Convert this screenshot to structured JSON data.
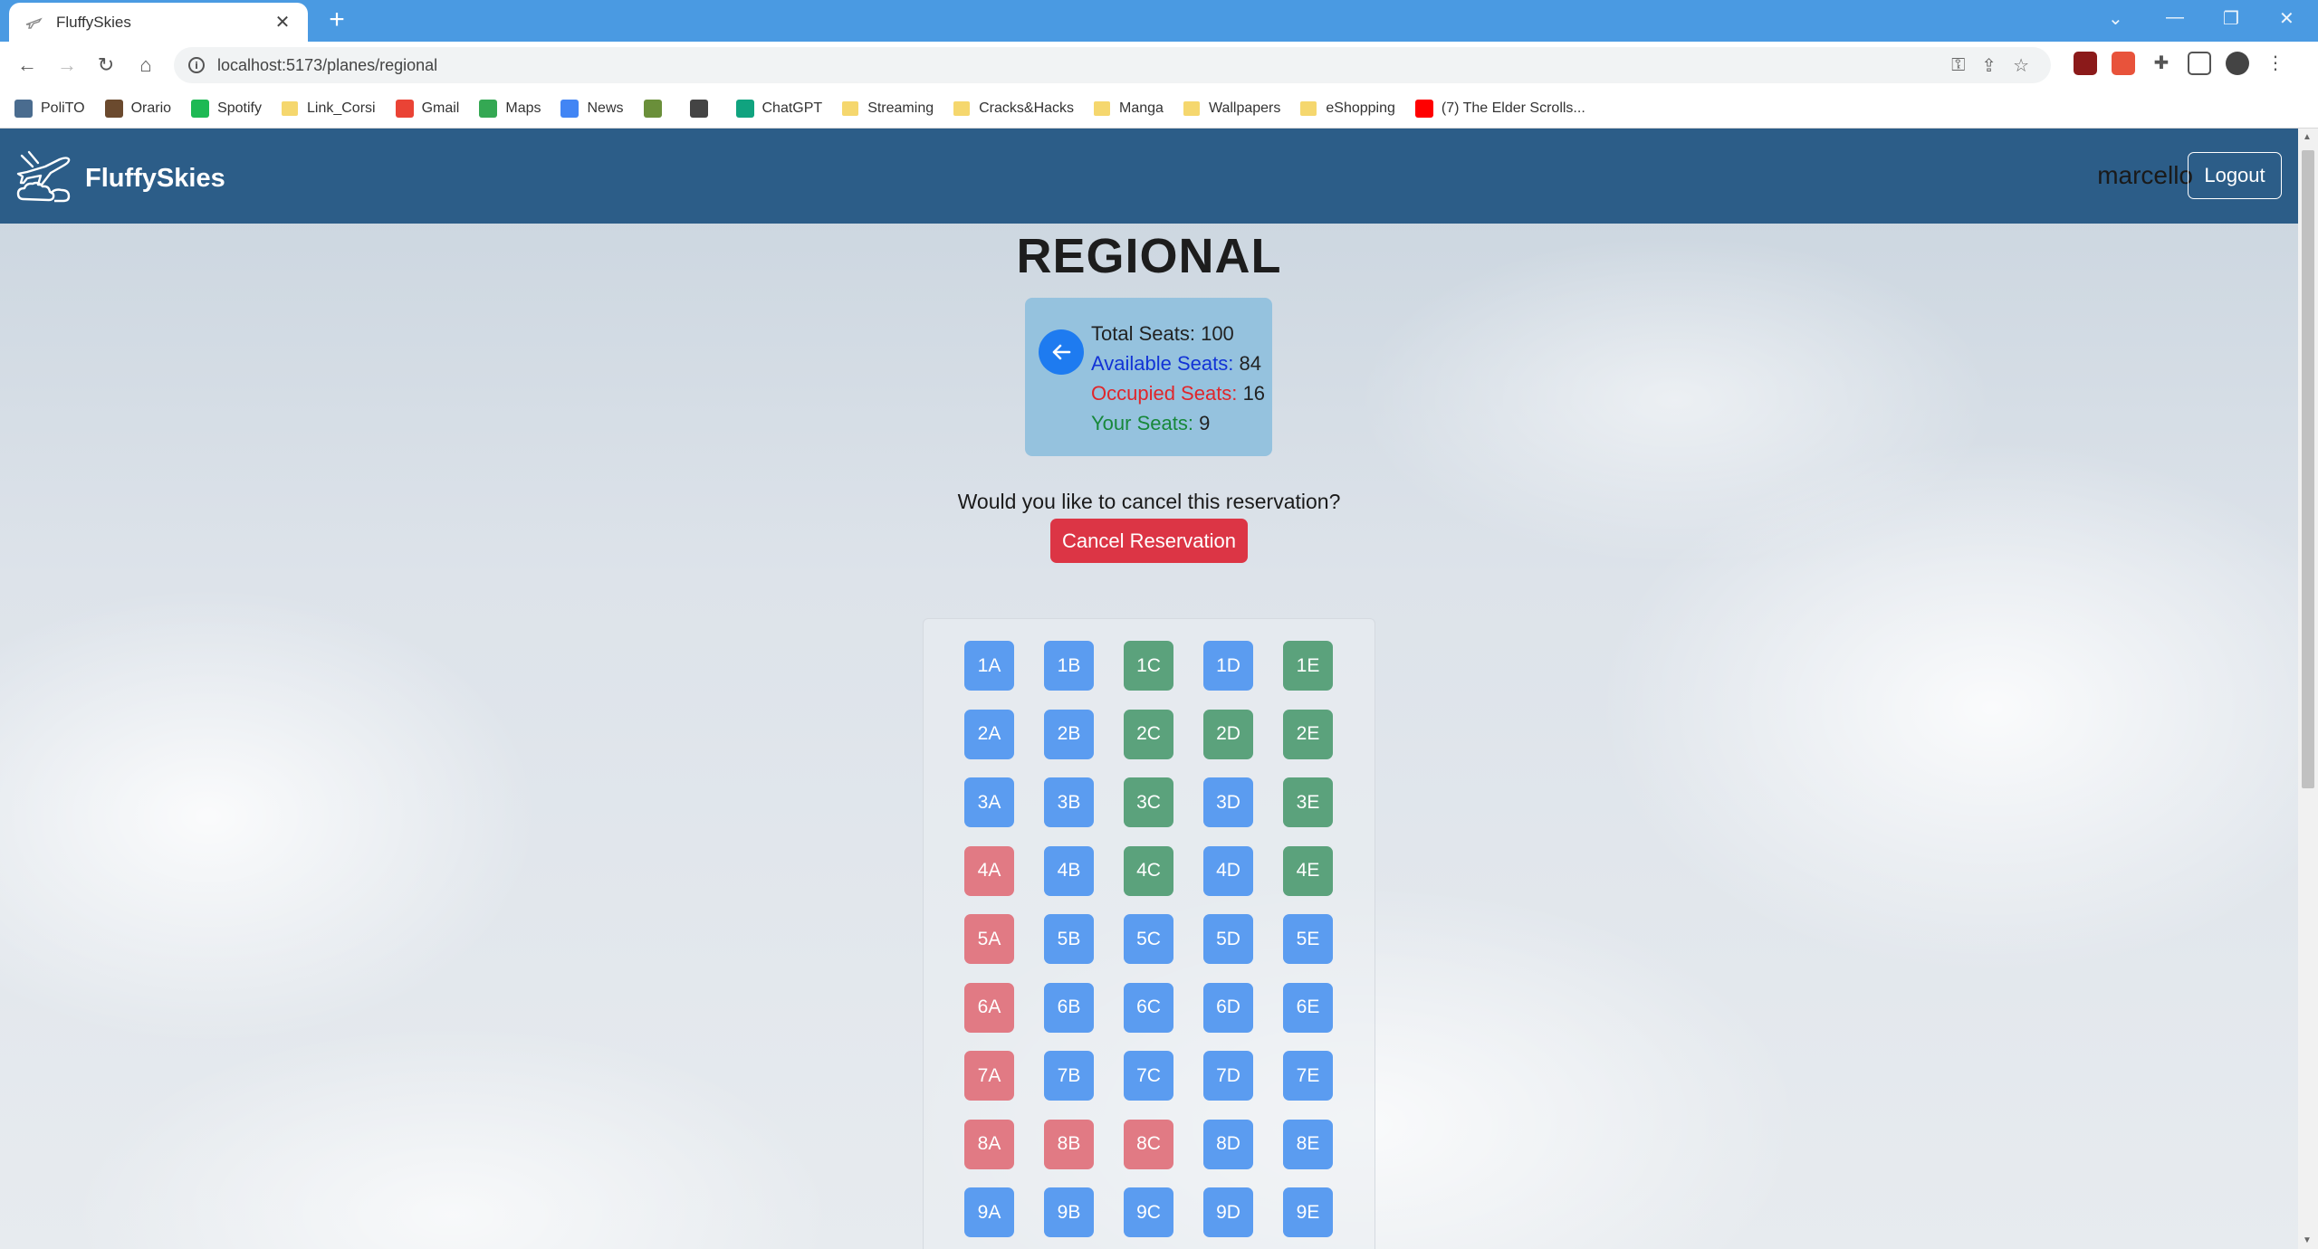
{
  "browser": {
    "tab_title": "FluffySkies",
    "url": "localhost:5173/planes/regional",
    "bookmarks": [
      {
        "label": "PoliTO",
        "color": "#4a6c8f"
      },
      {
        "label": "Orario",
        "color": "#6b4a2e"
      },
      {
        "label": "Spotify",
        "color": "#1db954"
      },
      {
        "label": "Link_Corsi",
        "color": "#f5d76e"
      },
      {
        "label": "Gmail",
        "color": "#ea4335"
      },
      {
        "label": "Maps",
        "color": "#34a853"
      },
      {
        "label": "News",
        "color": "#4285f4"
      },
      {
        "label": "",
        "color": "#6a8f3a"
      },
      {
        "label": "",
        "color": "#444444"
      },
      {
        "label": "ChatGPT",
        "color": "#10a37f"
      },
      {
        "label": "Streaming",
        "color": "#f5d76e"
      },
      {
        "label": "Cracks&Hacks",
        "color": "#f5d76e"
      },
      {
        "label": "Manga",
        "color": "#f5d76e"
      },
      {
        "label": "Wallpapers",
        "color": "#f5d76e"
      },
      {
        "label": "eShopping",
        "color": "#f5d76e"
      },
      {
        "label": "(7) The Elder Scrolls...",
        "color": "#ff0000"
      }
    ]
  },
  "navbar": {
    "brand": "FluffySkies",
    "username": "marcello",
    "logout_label": "Logout"
  },
  "plane": {
    "title": "REGIONAL",
    "total_label": "Total Seats:",
    "total_value": "100",
    "available_label": "Available Seats:",
    "available_value": "84",
    "occupied_label": "Occupied Seats:",
    "occupied_value": "16",
    "yours_label": "Your Seats:",
    "yours_value": "9"
  },
  "reservation": {
    "question": "Would you like to cancel this reservation?",
    "cancel_label": "Cancel Reservation"
  },
  "colors": {
    "available": "#5b9cf0",
    "yours": "#5ba27c",
    "occupied": "#e17a84",
    "navbar": "#2c5d88",
    "danger": "#dc3545"
  },
  "seats": [
    [
      {
        "id": "1A",
        "status": "available"
      },
      {
        "id": "1B",
        "status": "available"
      },
      {
        "id": "1C",
        "status": "yours"
      },
      {
        "id": "1D",
        "status": "available"
      },
      {
        "id": "1E",
        "status": "yours"
      }
    ],
    [
      {
        "id": "2A",
        "status": "available"
      },
      {
        "id": "2B",
        "status": "available"
      },
      {
        "id": "2C",
        "status": "yours"
      },
      {
        "id": "2D",
        "status": "yours"
      },
      {
        "id": "2E",
        "status": "yours"
      }
    ],
    [
      {
        "id": "3A",
        "status": "available"
      },
      {
        "id": "3B",
        "status": "available"
      },
      {
        "id": "3C",
        "status": "yours"
      },
      {
        "id": "3D",
        "status": "available"
      },
      {
        "id": "3E",
        "status": "yours"
      }
    ],
    [
      {
        "id": "4A",
        "status": "occupied"
      },
      {
        "id": "4B",
        "status": "available"
      },
      {
        "id": "4C",
        "status": "yours"
      },
      {
        "id": "4D",
        "status": "available"
      },
      {
        "id": "4E",
        "status": "yours"
      }
    ],
    [
      {
        "id": "5A",
        "status": "occupied"
      },
      {
        "id": "5B",
        "status": "available"
      },
      {
        "id": "5C",
        "status": "available"
      },
      {
        "id": "5D",
        "status": "available"
      },
      {
        "id": "5E",
        "status": "available"
      }
    ],
    [
      {
        "id": "6A",
        "status": "occupied"
      },
      {
        "id": "6B",
        "status": "available"
      },
      {
        "id": "6C",
        "status": "available"
      },
      {
        "id": "6D",
        "status": "available"
      },
      {
        "id": "6E",
        "status": "available"
      }
    ],
    [
      {
        "id": "7A",
        "status": "occupied"
      },
      {
        "id": "7B",
        "status": "available"
      },
      {
        "id": "7C",
        "status": "available"
      },
      {
        "id": "7D",
        "status": "available"
      },
      {
        "id": "7E",
        "status": "available"
      }
    ],
    [
      {
        "id": "8A",
        "status": "occupied"
      },
      {
        "id": "8B",
        "status": "occupied"
      },
      {
        "id": "8C",
        "status": "occupied"
      },
      {
        "id": "8D",
        "status": "available"
      },
      {
        "id": "8E",
        "status": "available"
      }
    ],
    [
      {
        "id": "9A",
        "status": "available"
      },
      {
        "id": "9B",
        "status": "available"
      },
      {
        "id": "9C",
        "status": "available"
      },
      {
        "id": "9D",
        "status": "available"
      },
      {
        "id": "9E",
        "status": "available"
      }
    ]
  ]
}
